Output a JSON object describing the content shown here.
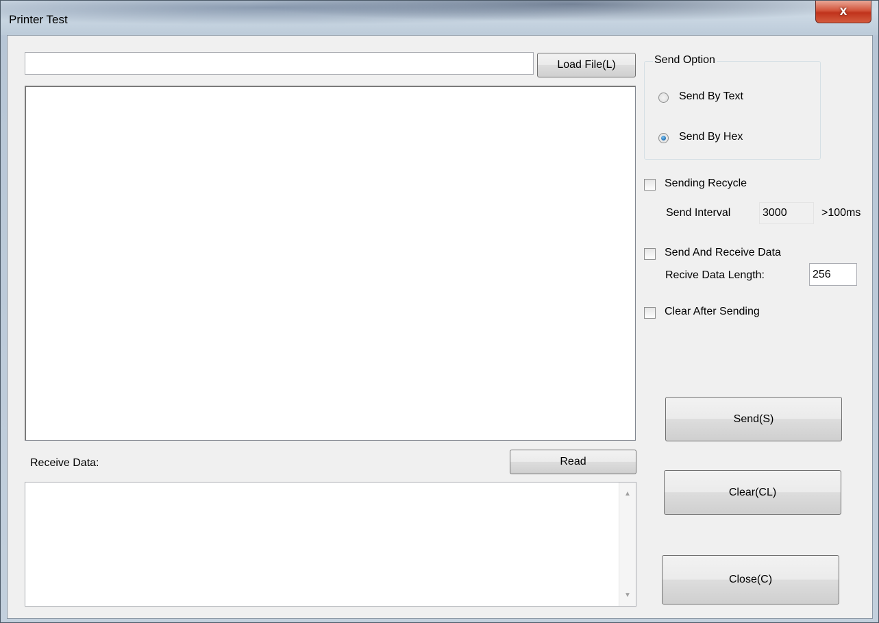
{
  "window": {
    "title": "Printer Test",
    "close_glyph": "x"
  },
  "file": {
    "path_value": "",
    "load_button": "Load File(L)"
  },
  "send_option": {
    "title": "Send Option",
    "options": [
      {
        "label": "Send By Text",
        "selected": false
      },
      {
        "label": "Send By Hex",
        "selected": true
      }
    ]
  },
  "recycle": {
    "checkbox_label": "Sending Recycle",
    "checked": false,
    "interval_label": "Send Interval",
    "interval_value": "3000",
    "interval_hint": ">100ms"
  },
  "send_receive": {
    "checkbox_label": "Send And Receive Data",
    "checked": false,
    "length_label": "Recive Data Length:",
    "length_value": "256"
  },
  "clear_after": {
    "checkbox_label": "Clear After Sending",
    "checked": false
  },
  "receive": {
    "label": "Receive Data:",
    "read_button": "Read",
    "content": ""
  },
  "buttons": {
    "send": "Send(S)",
    "clear": "Clear(CL)",
    "close": "Close(C)"
  },
  "icons": {
    "close": "close-icon",
    "scroll_up": "scroll-up-icon",
    "scroll_down": "scroll-down-icon"
  }
}
